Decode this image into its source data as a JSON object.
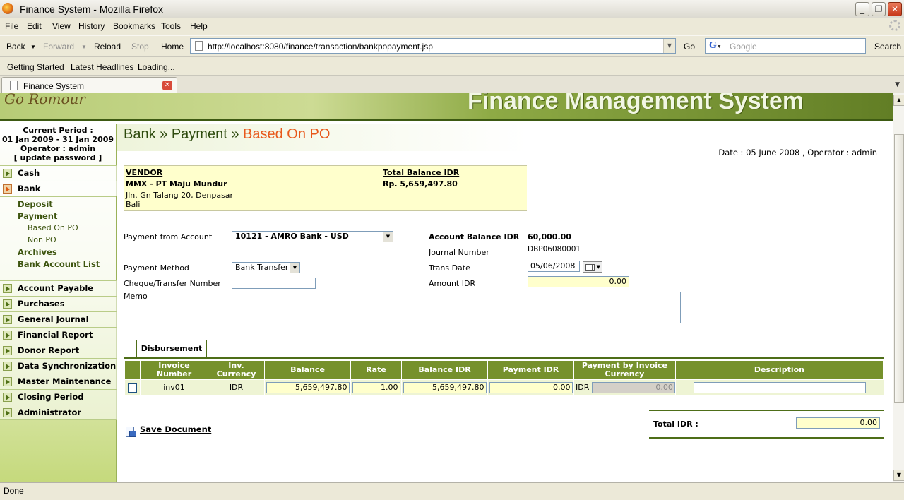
{
  "window": {
    "title": "Finance System - Mozilla Firefox"
  },
  "menu": [
    "File",
    "Edit",
    "View",
    "History",
    "Bookmarks",
    "Tools",
    "Help"
  ],
  "nav": {
    "back": "Back",
    "forward": "Forward",
    "reload": "Reload",
    "stop": "Stop",
    "home": "Home",
    "url": "http://localhost:8080/finance/transaction/bankpopayment.jsp",
    "go": "Go",
    "search_placeholder": "Google",
    "search": "Search"
  },
  "bookmarks": [
    "Getting Started",
    "Latest Headlines",
    "Loading..."
  ],
  "tab": {
    "label": "Finance System"
  },
  "banner": {
    "logo": "Go Romour",
    "title": "Finance Management System"
  },
  "sidebar": {
    "period_label": "Current Period :",
    "period": "01 Jan 2009 - 31 Jan 2009",
    "operator": "Operator : admin",
    "update_password": "[ update password ]",
    "items": {
      "cash": "Cash",
      "bank": "Bank",
      "account_payable": "Account Payable",
      "purchases": "Purchases",
      "general_journal": "General Journal",
      "financial_report": "Financial Report",
      "donor_report": "Donor Report",
      "data_sync": "Data Synchronization",
      "master_maintenance": "Master Maintenance",
      "closing_period": "Closing Period",
      "administrator": "Administrator"
    },
    "bank_sub": {
      "deposit": "Deposit",
      "payment": "Payment",
      "based_on_po": "Based On PO",
      "non_po": "Non PO",
      "archives": "Archives",
      "bank_account_list": "Bank Account List"
    }
  },
  "page": {
    "crumb1": "Bank",
    "sep1": " » ",
    "crumb2": "Payment",
    "sep2": " » ",
    "crumb3": "Based On PO",
    "date_op": "Date : 05 June 2008 ,  Operator : admin"
  },
  "vendor": {
    "header": "VENDOR",
    "name": "MMX - PT Maju Mundur",
    "address1": "Jln. Gn Talang 20, Denpasar",
    "address2": "Bali",
    "balance_header": "Total Balance IDR",
    "balance_value": "Rp. 5,659,497.80"
  },
  "form": {
    "payment_from_label": "Payment from Account",
    "payment_from_value": "10121 - AMRO Bank - USD",
    "payment_method_label": "Payment Method",
    "payment_method_value": "Bank Transfer",
    "cheque_label": "Cheque/Transfer Number",
    "memo_label": "Memo",
    "acct_balance_label": "Account Balance IDR",
    "acct_balance_value": "60,000.00",
    "journal_label": "Journal Number",
    "journal_value": "DBP06080001",
    "trans_date_label": "Trans Date",
    "trans_date_value": "05/06/2008",
    "amount_label": "Amount IDR",
    "amount_value": "0.00"
  },
  "disbursement": {
    "tab": "Disbursement",
    "headers": [
      "Invoice Number",
      "Inv. Currency",
      "Balance",
      "Rate",
      "Balance IDR",
      "Payment IDR",
      "Payment by Invoice Currency",
      "Description"
    ],
    "rows": [
      {
        "invoice": "inv01",
        "currency": "IDR",
        "balance": "5,659,497.80",
        "rate": "1.00",
        "balance_idr": "5,659,497.80",
        "payment_idr": "0.00",
        "inv_cur": "IDR",
        "payment_inv": "0.00",
        "description": ""
      }
    ]
  },
  "totals": {
    "label": "Total IDR :",
    "value": "0.00"
  },
  "save": "Save Document",
  "status": "Done"
}
